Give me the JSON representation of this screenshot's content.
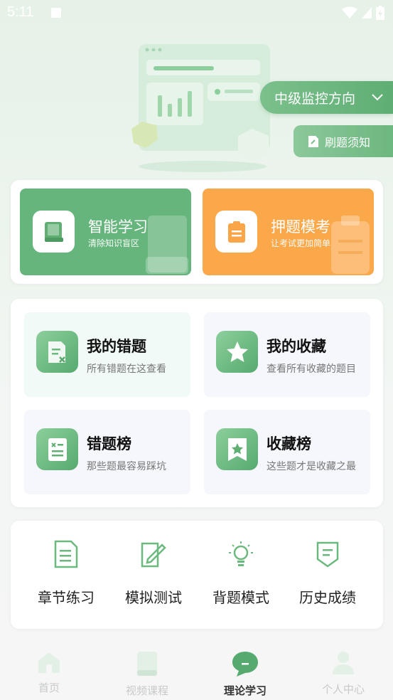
{
  "status": {
    "time": "5:11"
  },
  "header": {
    "direction_label": "中级监控方向",
    "notice_label": "刷题须知"
  },
  "feature_cards": [
    {
      "title": "智能学习",
      "subtitle": "清除知识盲区"
    },
    {
      "title": "押题模考",
      "subtitle": "让考试更加简单"
    }
  ],
  "practice": [
    {
      "title": "我的错题",
      "subtitle": "所有错题在这查看"
    },
    {
      "title": "我的收藏",
      "subtitle": "查看所有收藏的题目"
    },
    {
      "title": "错题榜",
      "subtitle": "那些题最容易踩坑"
    },
    {
      "title": "收藏榜",
      "subtitle": "这些题才是收藏之最"
    }
  ],
  "tools": [
    {
      "label": "章节练习",
      "icon": "document-icon"
    },
    {
      "label": "模拟测试",
      "icon": "edit-icon"
    },
    {
      "label": "背题模式",
      "icon": "lightbulb-icon"
    },
    {
      "label": "历史成绩",
      "icon": "shield-icon"
    }
  ],
  "tabs": [
    {
      "label": "首页",
      "icon": "home-icon"
    },
    {
      "label": "视频课程",
      "icon": "book-icon"
    },
    {
      "label": "理论学习",
      "icon": "chat-icon"
    },
    {
      "label": "个人中心",
      "icon": "user-icon"
    }
  ],
  "colors": {
    "green": "#66b57c",
    "orange": "#fba84b"
  }
}
